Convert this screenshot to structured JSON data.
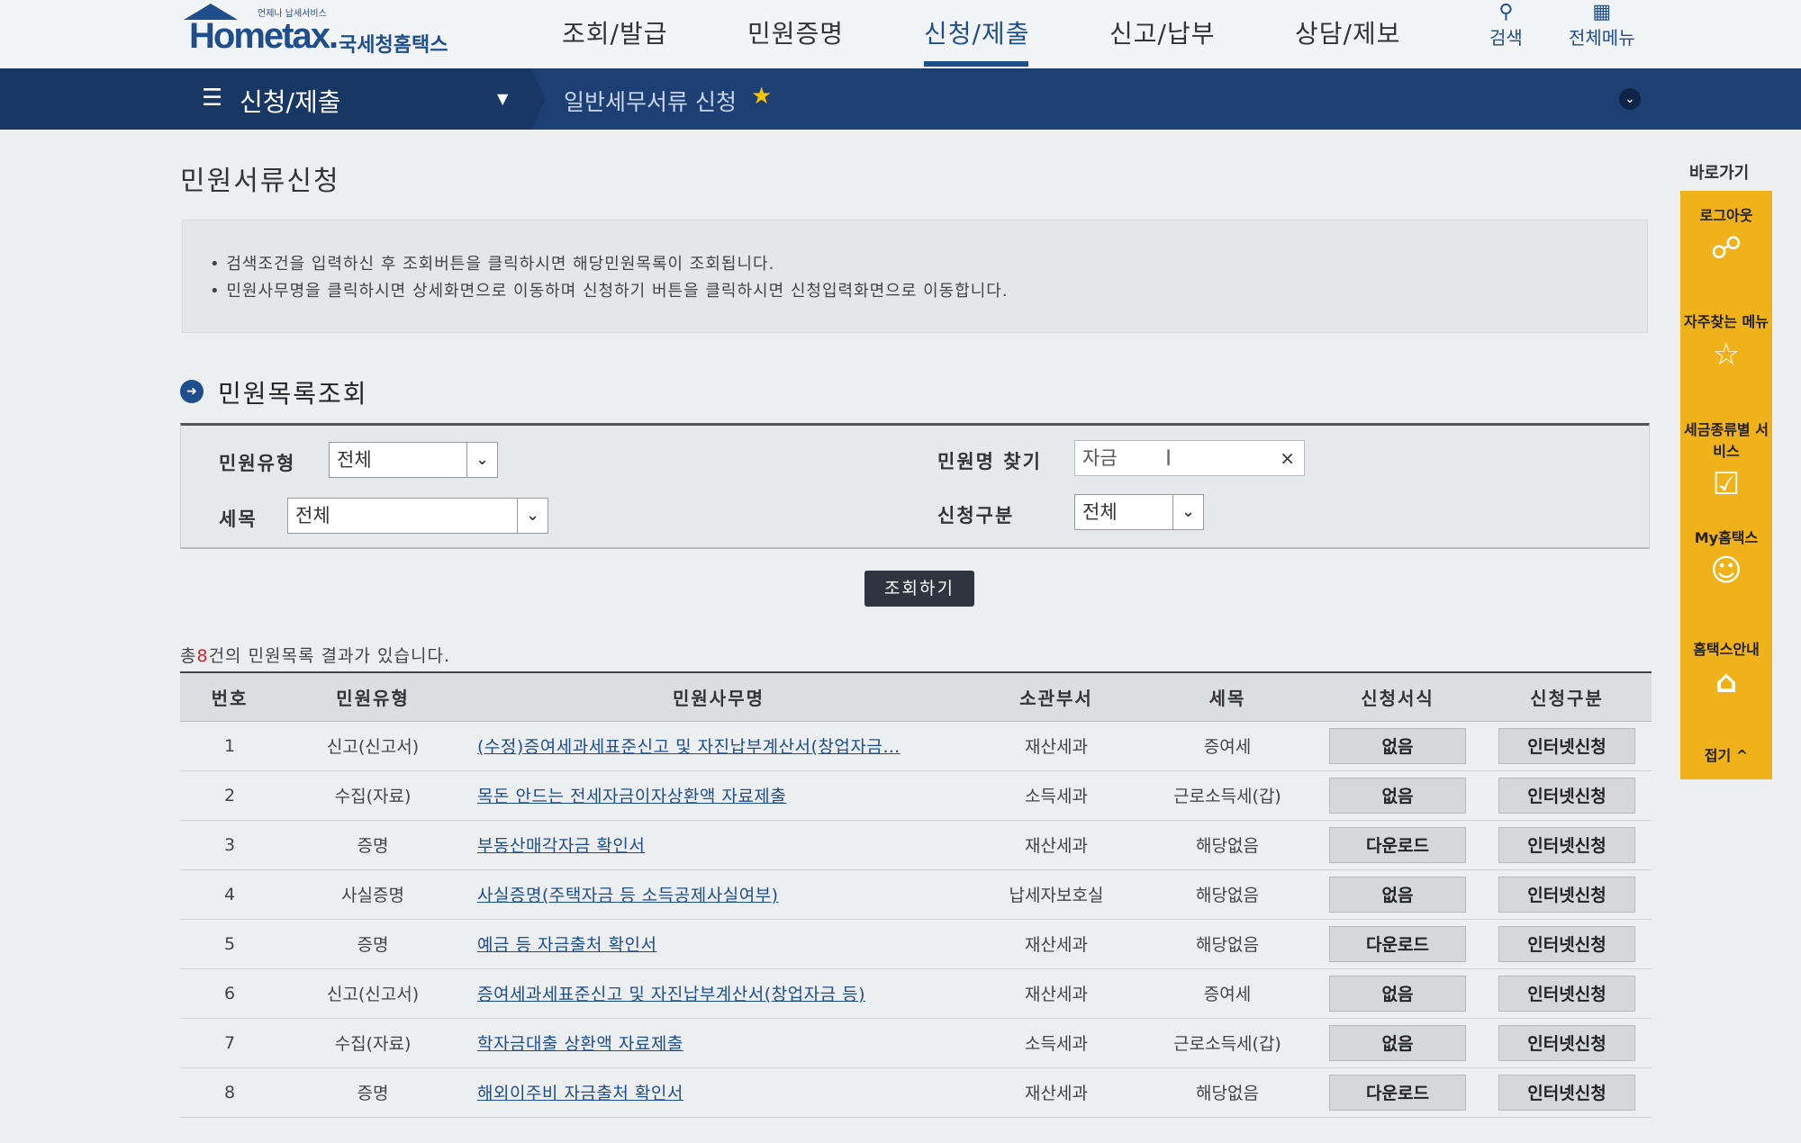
{
  "header": {
    "logo_text": "Hometax.",
    "logo_kr": "국세청홈택스",
    "logo_tagline": "언제나 납세서비스",
    "nav": [
      "조회/발급",
      "민원증명",
      "신청/제출",
      "신고/납부",
      "상담/제보"
    ],
    "active_nav": "신청/제출",
    "search_label": "검색",
    "allmenu_label": "전체메뉴"
  },
  "subnav": {
    "title": "신청/제출",
    "current": "일반세무서류 신청"
  },
  "page": {
    "title": "민원서류신청",
    "notices": [
      "• 검색조건을 입력하신 후 조회버튼을 클릭하시면 해당민원목록이 조회됩니다.",
      "• 민원사무명을 클릭하시면 상세화면으로 이동하며  신청하기 버튼을 클릭하시면 신청입력화면으로 이동합니다."
    ],
    "section_title": "민원목록조회"
  },
  "search": {
    "type_label": "민원유형",
    "type_value": "전체",
    "tax_label": "세목",
    "tax_value": "전체",
    "keyword_label": "민원명 찾기",
    "keyword_value": "자금",
    "apply_label": "신청구분",
    "apply_value": "전체",
    "button_label": "조회하기"
  },
  "result": {
    "prefix": "총",
    "count": "8",
    "suffix": "건의 민원목록 결과가 있습니다."
  },
  "table": {
    "headers": [
      "번호",
      "민원유형",
      "민원사무명",
      "소관부서",
      "세목",
      "신청서식",
      "신청구분"
    ],
    "rows": [
      [
        "1",
        "신고(신고서)",
        "(수정)증여세과세표준신고 및 자진납부계산서(창업자금…",
        "재산세과",
        "증여세",
        "없음",
        "인터넷신청"
      ],
      [
        "2",
        "수집(자료)",
        "목돈 안드는 전세자금이자상환액 자료제출",
        "소득세과",
        "근로소득세(갑)",
        "없음",
        "인터넷신청"
      ],
      [
        "3",
        "증명",
        "부동산매각자금 확인서",
        "재산세과",
        "해당없음",
        "다운로드",
        "인터넷신청"
      ],
      [
        "4",
        "사실증명",
        "사실증명(주택자금 등 소득공제사실여부)",
        "납세자보호실",
        "해당없음",
        "없음",
        "인터넷신청"
      ],
      [
        "5",
        "증명",
        "예금 등 자금출처 확인서",
        "재산세과",
        "해당없음",
        "다운로드",
        "인터넷신청"
      ],
      [
        "6",
        "신고(신고서)",
        "증여세과세표준신고 및 자진납부계산서(창업자금 등)",
        "재산세과",
        "증여세",
        "없음",
        "인터넷신청"
      ],
      [
        "7",
        "수집(자료)",
        "학자금대출 상환액 자료제출",
        "소득세과",
        "근로소득세(갑)",
        "없음",
        "인터넷신청"
      ],
      [
        "8",
        "증명",
        "해외이주비 자금출처 확인서",
        "재산세과",
        "해당없음",
        "다운로드",
        "인터넷신청"
      ]
    ]
  },
  "quick": {
    "title": "바로가기",
    "items": [
      "로그아웃",
      "자주찾는 메뉴",
      "세금종류별 서비스",
      "My홈택스",
      "홈택스안내",
      "접기 ^"
    ]
  }
}
